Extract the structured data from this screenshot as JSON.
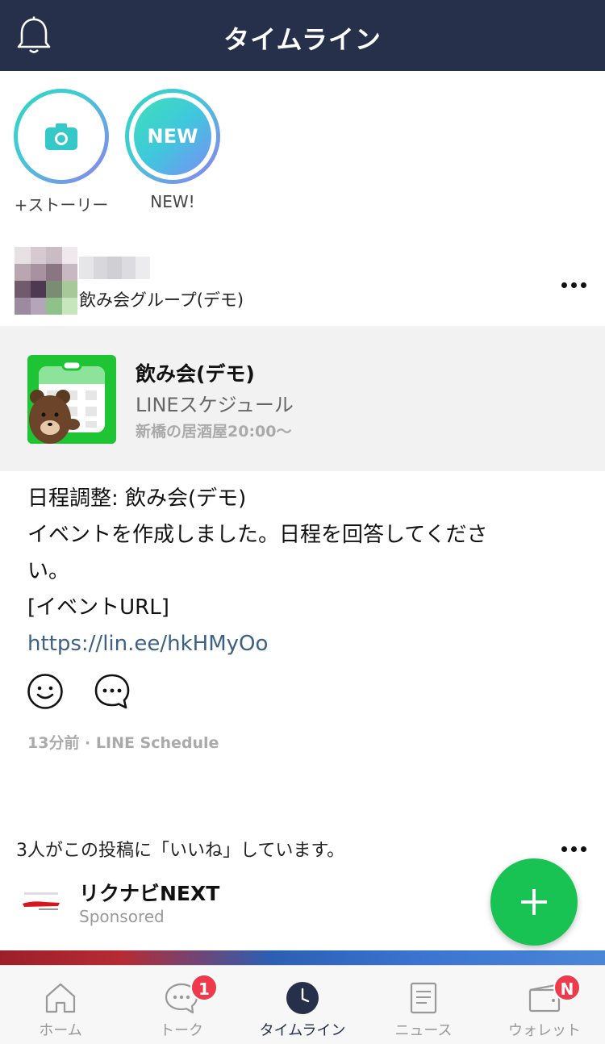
{
  "header": {
    "title": "タイムライン"
  },
  "stories": [
    {
      "label": "+ストーリー"
    },
    {
      "label": "NEW!",
      "badge_text": "NEW"
    }
  ],
  "post": {
    "group_name": "飲み会グループ(デモ)",
    "card": {
      "title": "飲み会(デモ)",
      "subtitle": "LINEスケジュール",
      "detail": "新橋の居酒屋20:00〜"
    },
    "text_lines": [
      "日程調整: 飲み会(デモ)",
      "イベントを作成しました。日程を回答してくださ",
      "い。",
      "[イベントURL]"
    ],
    "link": "https://lin.ee/hkHMyOo",
    "meta": "13分前 · LINE Schedule"
  },
  "likes_text": "3人がこの投稿に「いいね」しています。",
  "sponsored": {
    "name": "リクナビNEXT",
    "tag": "Sponsored"
  },
  "tabs": [
    {
      "label": "ホーム"
    },
    {
      "label": "トーク",
      "badge": "1"
    },
    {
      "label": "タイムライン",
      "active": true
    },
    {
      "label": "ニュース"
    },
    {
      "label": "ウォレット",
      "badge": "N"
    }
  ],
  "colors": {
    "header_bg": "#26304a",
    "line_green": "#19c353",
    "badge_red": "#ee3a4a",
    "link": "#3c6183"
  }
}
